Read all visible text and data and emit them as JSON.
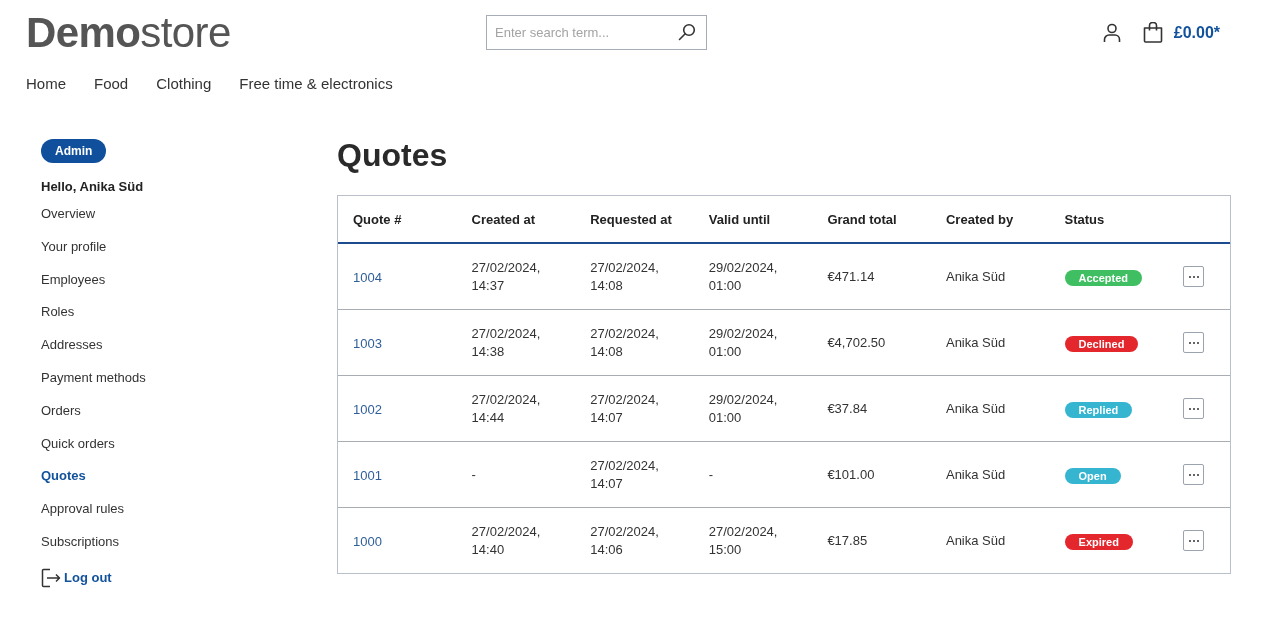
{
  "header": {
    "logo": "**Demo**store",
    "search": {
      "placeholder": "Enter search term..."
    },
    "cart_total": "£0.00*"
  },
  "nav": [
    "Home",
    "Food",
    "Clothing",
    "Free time & electronics"
  ],
  "sidebar": {
    "role_badge": "Admin",
    "greeting": "Hello, Anika Süd",
    "items": [
      {
        "label": "Overview",
        "selected": false
      },
      {
        "label": "Your profile",
        "selected": false
      },
      {
        "label": "Employees",
        "selected": false
      },
      {
        "label": "Roles",
        "selected": false
      },
      {
        "label": "Addresses",
        "selected": false
      },
      {
        "label": "Payment methods",
        "selected": false
      },
      {
        "label": "Orders",
        "selected": false
      },
      {
        "label": "Quick orders",
        "selected": false
      },
      {
        "label": "Quotes",
        "selected": true
      },
      {
        "label": "Approval rules",
        "selected": false
      },
      {
        "label": "Subscriptions",
        "selected": false
      }
    ],
    "logout": "Log out"
  },
  "page_title": "Quotes",
  "table": {
    "columns": [
      "Quote #",
      "Created at",
      "Requested at",
      "Valid until",
      "Grand total",
      "Created by",
      "Status"
    ],
    "rows": [
      {
        "quote": "1004",
        "created_at": "27/02/2024, 14:37",
        "requested_at": "27/02/2024, 14:08",
        "valid_until": "29/02/2024, 01:00",
        "grand_total": "€471.14",
        "created_by": "Anika Süd",
        "status": {
          "label": "Accepted",
          "color": "#40bf62"
        }
      },
      {
        "quote": "1003",
        "created_at": "27/02/2024, 14:38",
        "requested_at": "27/02/2024, 14:08",
        "valid_until": "29/02/2024, 01:00",
        "grand_total": "€4,702.50",
        "created_by": "Anika Süd",
        "status": {
          "label": "Declined",
          "color": "#e4262d"
        }
      },
      {
        "quote": "1002",
        "created_at": "27/02/2024, 14:44",
        "requested_at": "27/02/2024, 14:07",
        "valid_until": "29/02/2024, 01:00",
        "grand_total": "€37.84",
        "created_by": "Anika Süd",
        "status": {
          "label": "Replied",
          "color": "#36b5d1"
        }
      },
      {
        "quote": "1001",
        "created_at": "-",
        "requested_at": "27/02/2024, 14:07",
        "valid_until": "-",
        "grand_total": "€101.00",
        "created_by": "Anika Süd",
        "status": {
          "label": "Open",
          "color": "#36b5d1"
        }
      },
      {
        "quote": "1000",
        "created_at": "27/02/2024, 14:40",
        "requested_at": "27/02/2024, 14:06",
        "valid_until": "27/02/2024, 15:00",
        "grand_total": "€17.85",
        "created_by": "Anika Süd",
        "status": {
          "label": "Expired",
          "color": "#e4262d"
        }
      }
    ]
  }
}
